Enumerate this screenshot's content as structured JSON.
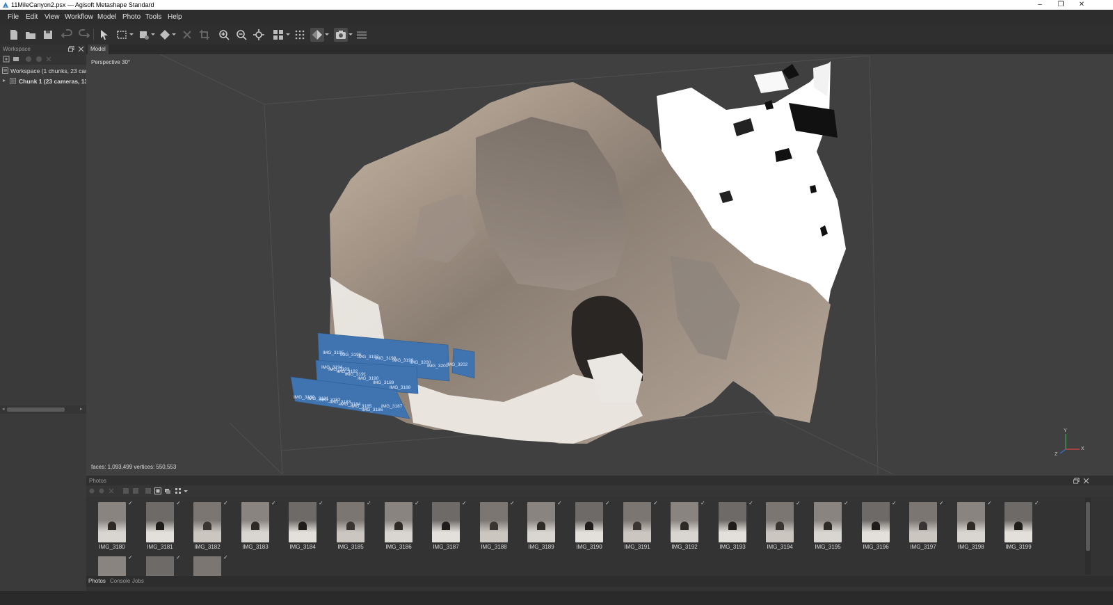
{
  "window": {
    "title": "11MileCanyon2.psx — Agisoft Metashape Standard",
    "minimize": "–",
    "maximize": "❐",
    "close": "✕"
  },
  "menu": [
    "File",
    "Edit",
    "View",
    "Workflow",
    "Model",
    "Photo",
    "Tools",
    "Help"
  ],
  "toolbar": {
    "icons": [
      "new-icon",
      "open-icon",
      "save-icon",
      "undo-icon",
      "redo-icon",
      "select-icon",
      "rect-select-icon",
      "shape-icon",
      "navigation-icon",
      "delete-icon",
      "crop-icon",
      "zoom-in-icon",
      "zoom-out-icon",
      "reset-view-icon",
      "show-cameras-icon",
      "grid-icon",
      "model-view-icon",
      "camera-icon",
      "layers-icon"
    ]
  },
  "workspace": {
    "panel_title": "Workspace",
    "root_label": "Workspace (1 chunks, 23 cameras",
    "chunk_label": "Chunk 1 (23 cameras, 13,58"
  },
  "viewport": {
    "tab_label": "Model",
    "projection": "Perspective 30°",
    "stats": "faces: 1,093,499 vertices: 550,553",
    "axis_x": "X",
    "axis_y": "Y",
    "axis_z": "Z"
  },
  "camera_labels": [
    "IMG_3195",
    "IMG_3196",
    "IMG_3197",
    "IMG_3198",
    "IMG_3199",
    "IMG_3200",
    "IMG_3201",
    "IMG_3202",
    "IMG_3194",
    "IMG_3193",
    "IMG_3192",
    "IMG_3191",
    "IMG_3190",
    "IMG_3189",
    "IMG_3188",
    "IMG_3180",
    "IMG_3181",
    "IMG_3182",
    "IMG_3183",
    "IMG_3184",
    "IMG_3185",
    "IMG_3186",
    "IMG_3187"
  ],
  "photos": {
    "panel_title": "Photos",
    "items": [
      "IMG_3180",
      "IMG_3181",
      "IMG_3182",
      "IMG_3183",
      "IMG_3184",
      "IMG_3185",
      "IMG_3186",
      "IMG_3187",
      "IMG_3188",
      "IMG_3189",
      "IMG_3190",
      "IMG_3191",
      "IMG_3192",
      "IMG_3193",
      "IMG_3194",
      "IMG_3195",
      "IMG_3196",
      "IMG_3197",
      "IMG_3198",
      "IMG_3199"
    ],
    "tabs": [
      "Photos",
      "Console",
      "Jobs"
    ],
    "active_tab": "Photos"
  },
  "colors": {
    "camera_plane": "#3f74b0",
    "background": "#404040",
    "panel": "#333333"
  }
}
